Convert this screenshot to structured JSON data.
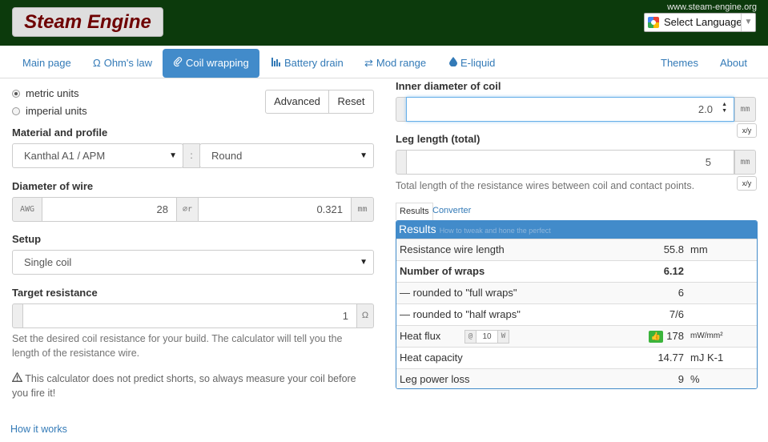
{
  "header": {
    "logo": "Steam Engine",
    "site_url": "www.steam-engine.org",
    "language": "Select Language"
  },
  "nav": {
    "tabs": [
      {
        "label": "Main page"
      },
      {
        "label": "Ohm's law",
        "icon": "Ω"
      },
      {
        "label": "Coil wrapping",
        "icon": "paperclip-icon"
      },
      {
        "label": "Battery drain",
        "icon": "bar-chart-icon"
      },
      {
        "label": "Mod range",
        "icon": "transfer-icon"
      },
      {
        "label": "E-liquid",
        "icon": "droplet-icon"
      },
      {
        "label": "Themes"
      },
      {
        "label": "About"
      }
    ]
  },
  "units": {
    "metric": "metric units",
    "imperial": "imperial units",
    "selected": "metric"
  },
  "buttons": {
    "advanced": "Advanced",
    "reset": "Reset"
  },
  "material": {
    "label": "Material and profile",
    "value": "Kanthal A1 / APM",
    "separator": ":",
    "profile": "Round"
  },
  "diameter": {
    "label": "Diameter of wire",
    "awg_addon": "AWG",
    "awg": "28",
    "dia_addon": "⌀r",
    "mm_value": "0.321",
    "unit": "mm"
  },
  "setup": {
    "label": "Setup",
    "value": "Single coil"
  },
  "target": {
    "label": "Target resistance",
    "value": "1",
    "unit": "Ω",
    "help": "Set the desired coil resistance for your build. The calculator will tell you the length of the resistance wire."
  },
  "warning": "This calculator does not predict shorts, so always measure your coil before you fire it!",
  "how_it_works": "How it works",
  "inner_diameter": {
    "label": "Inner diameter of coil",
    "value": "2.0",
    "unit": "mm",
    "ratio": "x/y"
  },
  "leg_length": {
    "label": "Leg length (total)",
    "value": "5",
    "unit": "mm",
    "ratio": "x/y",
    "help": "Total length of the resistance wires between coil and contact points."
  },
  "result_tabs": [
    "Results",
    "Converter"
  ],
  "results": {
    "title": "Results",
    "subtitle": "How to tweak and hone the perfect",
    "rows": [
      {
        "name": "Resistance wire length",
        "value": "55.8",
        "unit": "mm"
      },
      {
        "name": "Number of wraps",
        "value": "6.12",
        "unit": ""
      },
      {
        "name": "— rounded to \"full wraps\"",
        "value": "6",
        "unit": ""
      },
      {
        "name": "— rounded to \"half wraps\"",
        "value": "7/6",
        "unit": ""
      },
      {
        "name": "Heat flux",
        "value": "178",
        "unit": "mW/mm²",
        "input_prefix": "@",
        "input_value": "10",
        "input_suffix": "W"
      },
      {
        "name": "Heat capacity",
        "value": "14.77",
        "unit": "mJ K-1"
      },
      {
        "name": "Leg power loss",
        "value": "9",
        "unit": "%"
      }
    ]
  },
  "colors": {
    "header_bg": "#0c3a0c",
    "accent": "#428bca",
    "logo_text": "#6e0000",
    "good": "#3bb43b"
  }
}
